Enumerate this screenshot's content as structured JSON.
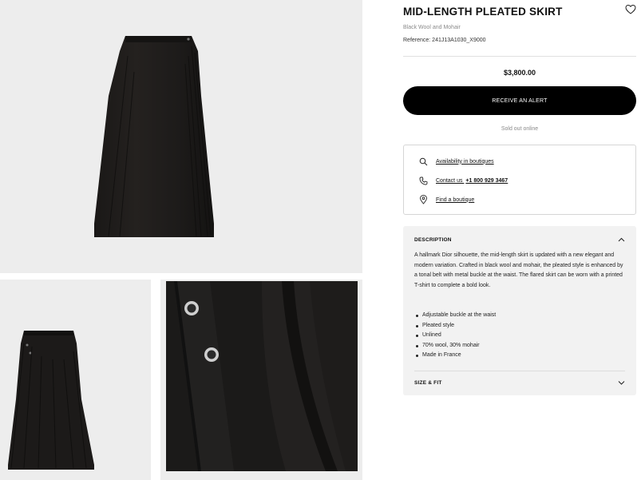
{
  "product": {
    "title": "MID-LENGTH PLEATED SKIRT",
    "material": "Black Wool and Mohair",
    "reference": "Reference: 241J13A1030_X9000",
    "price": "$3,800.00",
    "alert_button": "RECEIVE AN ALERT",
    "availability_status": "Sold out online"
  },
  "services": {
    "availability": "Availability in boutiques",
    "contact_prefix": "Contact us ",
    "contact_phone": "+1 800 929 3467",
    "find_boutique": "Find a boutique"
  },
  "description": {
    "heading": "DESCRIPTION",
    "text": "A hallmark Dior silhouette, the mid-length skirt is updated with a new elegant and modern variation. Crafted in black wool and mohair, the pleated style is enhanced by a tonal belt with metal buckle at the waist. The flared skirt can be worn with a printed T-shirt to complete a bold look.",
    "features": [
      "Adjustable buckle at the waist",
      "Pleated style",
      "Unlined",
      "70% wool, 30% mohair",
      "Made in France"
    ]
  },
  "size_fit": {
    "heading": "SIZE & FIT"
  },
  "icons": {
    "wishlist": "heart-icon",
    "availability": "search-icon",
    "contact": "phone-icon",
    "find": "map-pin-icon",
    "description_toggle": "chevron-up-icon",
    "size_toggle": "chevron-down-icon"
  },
  "colors": {
    "accent": "#000000",
    "panel_background": "#f2f2f2",
    "gallery_background": "#ededed",
    "muted_text": "#8a8a8a"
  }
}
